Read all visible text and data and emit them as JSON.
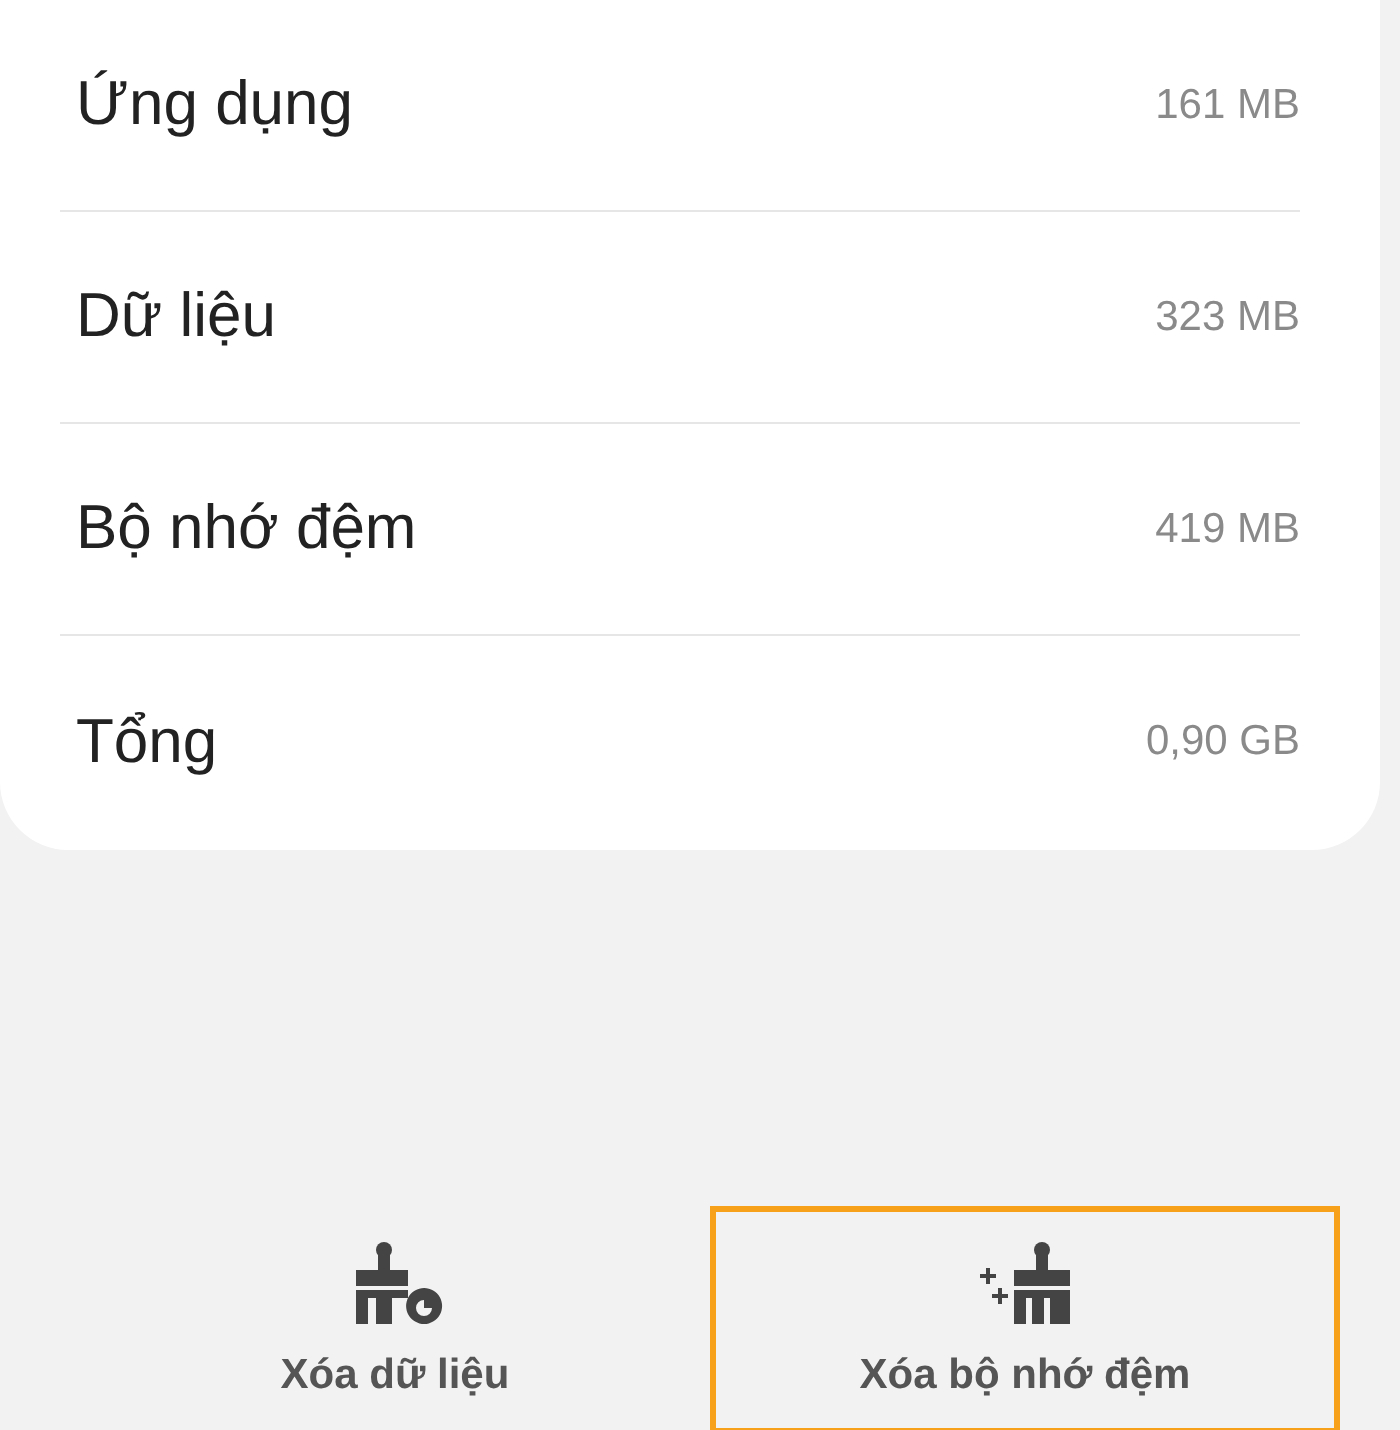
{
  "storage_rows": [
    {
      "label": "Ứng dụng",
      "value": "161 MB"
    },
    {
      "label": "Dữ liệu",
      "value": "323 MB"
    },
    {
      "label": "Bộ nhớ đệm",
      "value": "419 MB"
    },
    {
      "label": "Tổng",
      "value": "0,90 GB"
    }
  ],
  "actions": [
    {
      "kind": "clear-data",
      "label": "Xóa dữ liệu",
      "highlighted": false
    },
    {
      "kind": "clear-cache",
      "label": "Xóa bộ nhớ đệm",
      "highlighted": true
    }
  ]
}
